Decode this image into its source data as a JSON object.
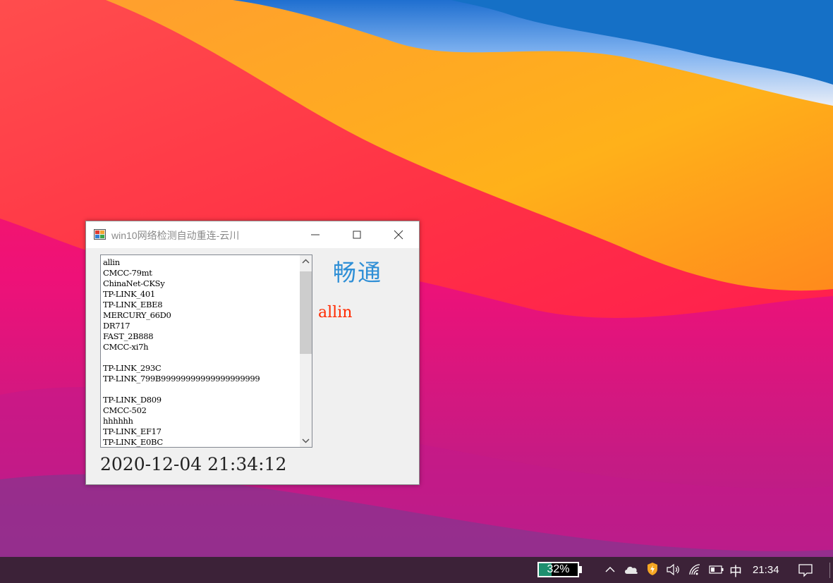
{
  "window": {
    "title": "win10网络检测自动重连-云川",
    "status_text": "畅通",
    "current_ssid": "allin",
    "datetime": "2020-12-04 21:34:12",
    "ssid_list": [
      "allin",
      "CMCC-79mt",
      "ChinaNet-CKSy",
      "TP-LINK_401",
      "TP-LINK_EBE8",
      "MERCURY_66D0",
      "DR717",
      "FAST_2B888",
      "CMCC-xi7h",
      "",
      "TP-LINK_293C",
      "TP-LINK_799B99999999999999999999",
      "",
      "TP-LINK_D809",
      "CMCC-502",
      "hhhhhh",
      "TP-LINK_EF17",
      "TP-LINK_E0BC"
    ],
    "colors": {
      "status": "#2f8fd6",
      "ssid": "#ff2a00"
    }
  },
  "taskbar": {
    "battery_percent": "32%",
    "battery_level": 0.32,
    "ime_label": "中",
    "clock": "21:34",
    "tray_icons": [
      "chevron-up-icon",
      "cloud-icon",
      "shield-icon",
      "speaker-icon",
      "wifi-icon",
      "battery-icon",
      "notification-icon"
    ]
  }
}
